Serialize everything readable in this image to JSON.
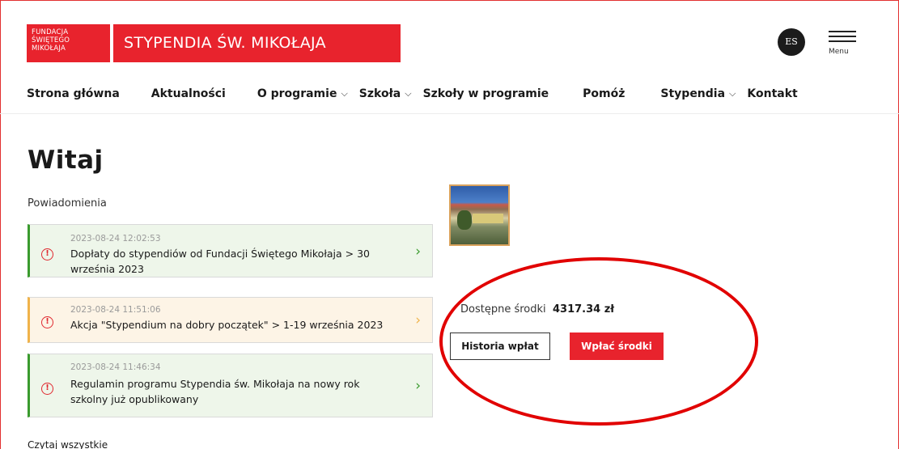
{
  "header": {
    "logo_lines": [
      "FUNDACJA",
      "ŚWIĘTEGO",
      "MIKOŁAJA"
    ],
    "site_title": "STYPENDIA ŚW. MIKOŁAJA",
    "lang": "ES",
    "menu_label": "Menu"
  },
  "nav": [
    {
      "label": "Strona główna"
    },
    {
      "label": "Aktualności"
    },
    {
      "label": "O programie",
      "chevron": "⌵"
    },
    {
      "label": "Szkoła",
      "chevron": "⌵"
    },
    {
      "label": "Szkoły w programie"
    },
    {
      "label": "Pomóż"
    },
    {
      "label": "Stypendia",
      "chevron": "⌵"
    },
    {
      "label": "Kontakt"
    }
  ],
  "page": {
    "title": "Witaj",
    "notifications_label": "Powiadomienia",
    "read_all": "Czytaj wszystkie"
  },
  "notifications": [
    {
      "date": "2023-08-24 12:02:53",
      "text": "Dopłaty do stypendiów od Fundacji Świętego Mikołaja > 30 września 2023",
      "status": "green"
    },
    {
      "date": "2023-08-24 11:51:06",
      "text": "Akcja \"Stypendium na dobry początek\" > 1-19 września 2023",
      "status": "orange"
    },
    {
      "date": "2023-08-24 11:46:34",
      "text": "Regulamin programu Stypendia św. Mikołaja na nowy rok szkolny już opublikowany",
      "status": "green"
    }
  ],
  "funds": {
    "label": "Dostępne środki",
    "value": "4317.34 zł",
    "history_button": "Historia wpłat",
    "pay_button": "Wpłać środki"
  },
  "colors": {
    "brand_red": "#e8232d",
    "success_green": "#3a9b2e",
    "warning_orange": "#f0b34a",
    "annotation_red": "#e10000"
  },
  "icons": {
    "warning": "warning-circle-icon",
    "arrow": "chevron-right-icon",
    "menu": "hamburger-icon"
  }
}
